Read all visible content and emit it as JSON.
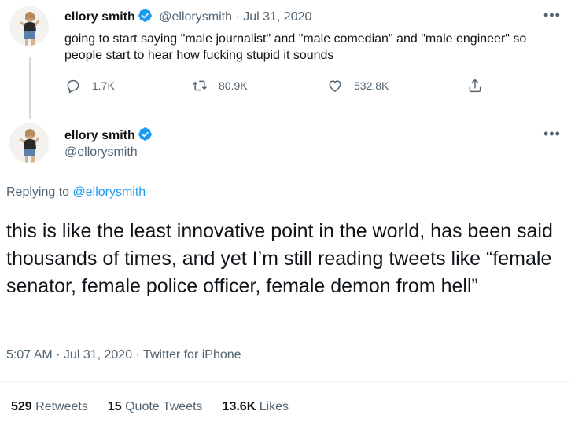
{
  "tweet1": {
    "name": "ellory smith",
    "handle": "@ellorysmith",
    "date": "Jul 31, 2020",
    "text": "going to start saying \"male journalist\" and \"male comedian\" and \"male engineer\" so people start to hear how fucking stupid it sounds",
    "replies": "1.7K",
    "retweets": "80.9K",
    "likes": "532.8K"
  },
  "tweet2": {
    "name": "ellory smith",
    "handle": "@ellorysmith",
    "replying_prefix": "Replying to",
    "replying_to": "@ellorysmith",
    "text": "this is like the least innovative point in the world, has been said thousands of times, and yet I’m still reading tweets like “female senator, female police officer, female demon from hell”",
    "timestamp": "5:07 AM",
    "date": "Jul 31, 2020",
    "source": "Twitter for iPhone"
  },
  "stats": {
    "retweets_count": "529",
    "retweets_label": "Retweets",
    "quotes_count": "15",
    "quotes_label": "Quote Tweets",
    "likes_count": "13.6K",
    "likes_label": "Likes"
  },
  "icons": {
    "more": "more-icon",
    "verified": "verified-badge-icon",
    "reply": "reply-icon",
    "retweet": "retweet-icon",
    "like": "like-icon",
    "share": "share-icon"
  },
  "colors": {
    "verified": "#1d9bf0",
    "link": "#1d9bf0",
    "secondary_text": "#536471"
  }
}
